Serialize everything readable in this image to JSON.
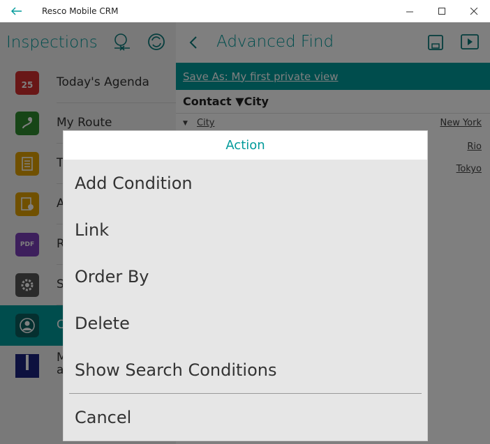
{
  "window": {
    "title": "Resco Mobile CRM"
  },
  "left": {
    "title": "Inspections",
    "items": [
      {
        "label": "Today's Agenda",
        "icon": "calendar-icon",
        "icon_text": "25",
        "color": "#d32f2f"
      },
      {
        "label": "My Route",
        "icon": "route-map-icon",
        "color": "#2e8b2e"
      },
      {
        "label": "T",
        "icon": "document-icon",
        "color": "#e0a000"
      },
      {
        "label": "A",
        "icon": "checklist-icon",
        "color": "#e0a000"
      },
      {
        "label": "R",
        "icon": "pdf-icon",
        "icon_text": "PDF",
        "color": "#7b3fb8"
      },
      {
        "label": "S",
        "icon": "gear-icon",
        "color": "#555555"
      },
      {
        "label": "C",
        "icon": "user-icon",
        "color": "#0a5f5f"
      },
      {
        "label": "M\na",
        "icon": "book-icon",
        "color": "#1a237e"
      }
    ]
  },
  "right": {
    "title": "Advanced Find",
    "save_as": "Save As: My first private view",
    "entity_header": "Contact ▼City",
    "conditions": [
      {
        "field": "City",
        "value": "New York"
      },
      {
        "field": "",
        "value": "Rio"
      },
      {
        "field": "",
        "value": "Tokyo"
      }
    ]
  },
  "dialog": {
    "title": "Action",
    "items": [
      "Add Condition",
      "Link",
      "Order By",
      "Delete",
      "Show Search Conditions"
    ],
    "cancel": "Cancel"
  },
  "colors": {
    "accent": "#009a9a"
  }
}
